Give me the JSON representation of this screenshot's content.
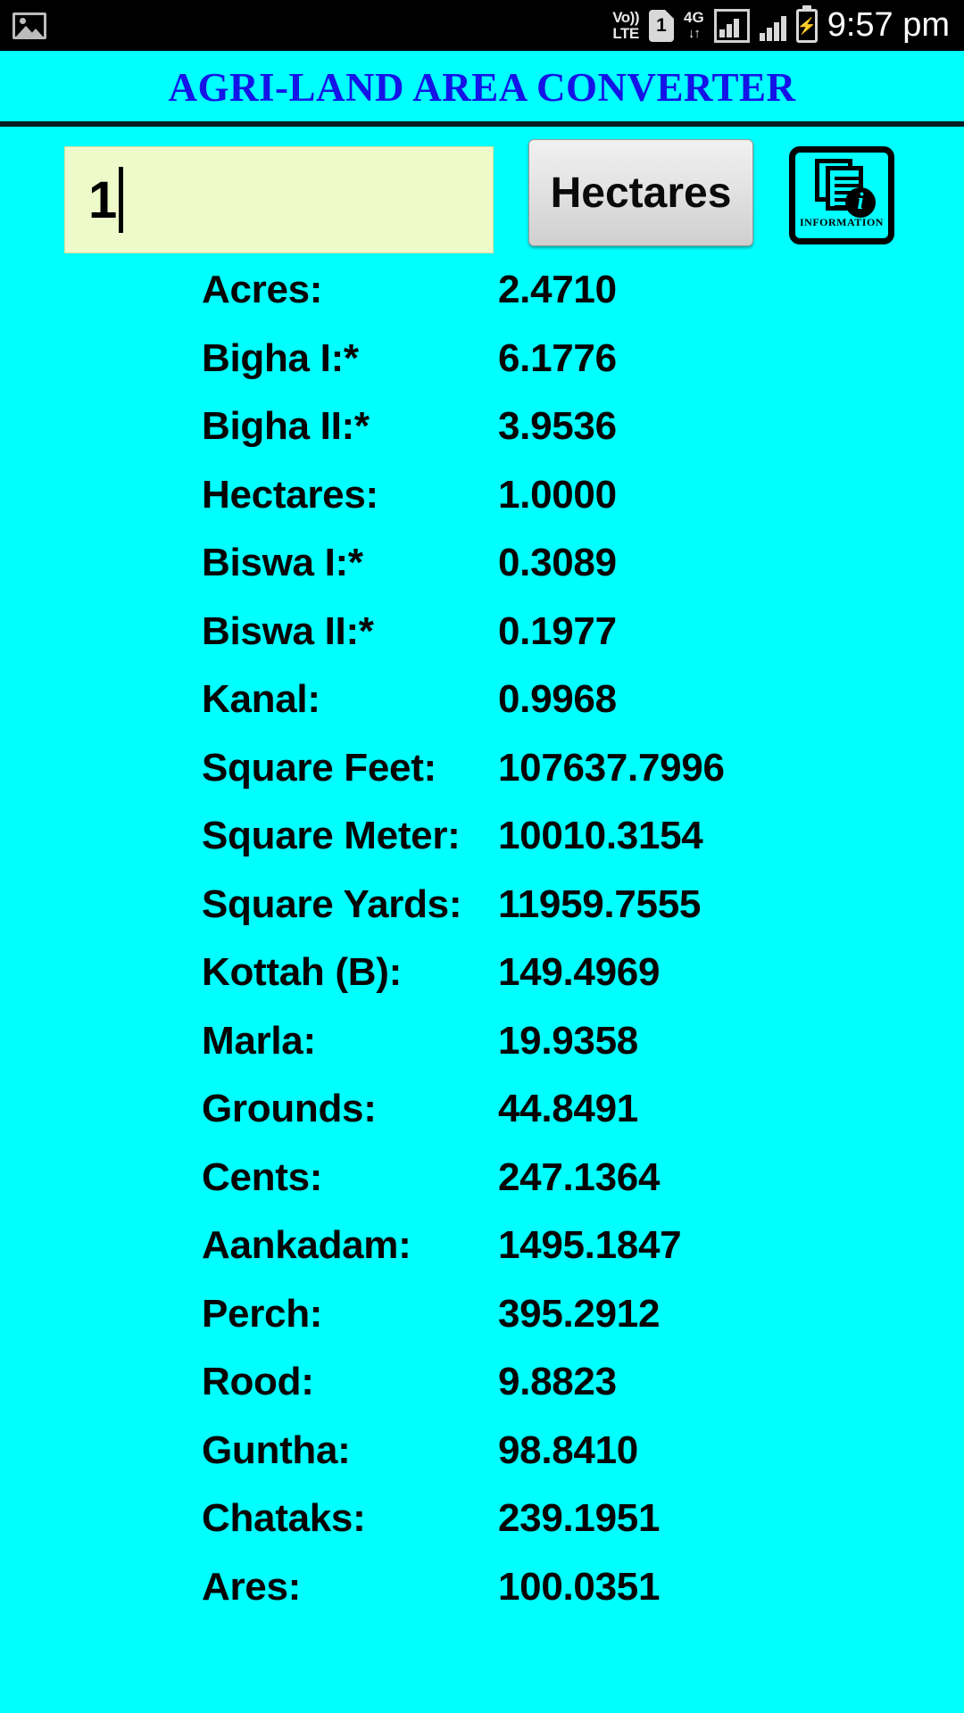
{
  "status_bar": {
    "gallery_icon": "image-icon",
    "volte_line1": "Vo))",
    "volte_line2": "LTE",
    "sim_label": "1",
    "network_type": "4G",
    "network_arrows": "↓↑",
    "signal_boxed_icon": "signal-bars-boxed-icon",
    "signal_icon": "signal-bars-icon",
    "battery_icon": "battery-charging-icon",
    "battery_bolt": "⚡",
    "time": "9:57 pm"
  },
  "header": {
    "title": "AGRI-LAND AREA CONVERTER",
    "title_color": "#1414E6"
  },
  "input": {
    "value": "1",
    "placeholder": "",
    "field_background": "#EFFACB"
  },
  "unit_button": {
    "label": "Hectares"
  },
  "info_button": {
    "caption": "INFORMATION",
    "icon": "information-documents-icon"
  },
  "theme": {
    "background": "#00FFFF",
    "text": "#050505",
    "divider": "#062024"
  },
  "results": {
    "rows": [
      {
        "label": "Acres:",
        "value": "2.4710"
      },
      {
        "label": "Bigha I:*",
        "value": "6.1776"
      },
      {
        "label": "Bigha II:*",
        "value": "3.9536"
      },
      {
        "label": "Hectares:",
        "value": "1.0000"
      },
      {
        "label": "Biswa I:*",
        "value": "0.3089"
      },
      {
        "label": "Biswa II:*",
        "value": "0.1977"
      },
      {
        "label": "Kanal:",
        "value": "0.9968"
      },
      {
        "label": "Square Feet:",
        "value": "107637.7996"
      },
      {
        "label": "Square Meter:",
        "value": "10010.3154"
      },
      {
        "label": "Square Yards:",
        "value": "11959.7555"
      },
      {
        "label": "Kottah (B):",
        "value": "149.4969"
      },
      {
        "label": "Marla:",
        "value": "19.9358"
      },
      {
        "label": "Grounds:",
        "value": "44.8491"
      },
      {
        "label": "Cents:",
        "value": "247.1364"
      },
      {
        "label": "Aankadam:",
        "value": "1495.1847"
      },
      {
        "label": "Perch:",
        "value": "395.2912"
      },
      {
        "label": "Rood:",
        "value": "9.8823"
      },
      {
        "label": "Guntha:",
        "value": "98.8410"
      },
      {
        "label": "Chataks:",
        "value": "239.1951"
      },
      {
        "label": "Ares:",
        "value": "100.0351"
      }
    ]
  }
}
